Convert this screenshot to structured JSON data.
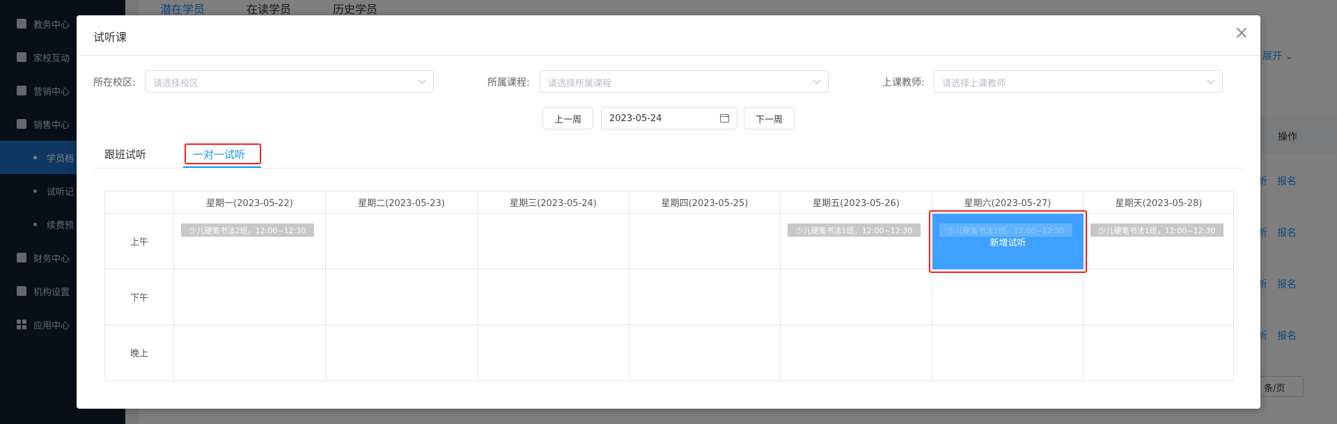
{
  "sidebar": {
    "items": [
      {
        "label": "教务中心",
        "icon": "book-icon"
      },
      {
        "label": "家校互动",
        "icon": "chat-icon"
      },
      {
        "label": "营销中心",
        "icon": "bag-icon"
      },
      {
        "label": "销售中心",
        "icon": "chart-icon"
      },
      {
        "label": "财务中心",
        "icon": "finance-icon"
      },
      {
        "label": "机构设置",
        "icon": "gear-icon"
      },
      {
        "label": "应用中心",
        "icon": "apps-icon"
      }
    ],
    "subitems": [
      {
        "label": "学员档",
        "active": true
      },
      {
        "label": "试听记",
        "active": false
      },
      {
        "label": "续费预",
        "active": false
      }
    ]
  },
  "main": {
    "tabs": [
      "潜在学员",
      "在读学员",
      "历史学员"
    ],
    "expand_label": "展开",
    "op_header": "操作",
    "row_links": [
      "报名",
      "报名",
      "报名",
      "报名"
    ],
    "partial_links": [
      "听",
      "听",
      "听",
      "听"
    ],
    "pager_label": "条/页"
  },
  "dialog": {
    "title": "试听课",
    "filters": {
      "campus_label": "所在校区:",
      "campus_placeholder": "请选择校区",
      "course_label": "所属课程:",
      "course_placeholder": "请选择所属课程",
      "teacher_label": "上课教师:",
      "teacher_placeholder": "请选择上课教师"
    },
    "week_nav": {
      "prev_label": "上一周",
      "date_value": "2023-05-24",
      "next_label": "下一周"
    },
    "tabs": [
      "跟班试听",
      "一对一试听"
    ],
    "active_tab": "一对一试听",
    "schedule": {
      "days": [
        "星期一(2023-05-22)",
        "星期二(2023-05-23)",
        "星期三(2023-05-24)",
        "星期四(2023-05-25)",
        "星期五(2023-05-26)",
        "星期六(2023-05-27)",
        "星期天(2023-05-28)"
      ],
      "periods": [
        "上午",
        "下午",
        "晚上"
      ],
      "lessons": {
        "mon_am": "少儿硬笔书法2班，12:00~12:30",
        "fri_am": "少儿硬笔书法1班，12:00~12:30",
        "sat_am_hidden": "少儿硬笔书法1班，12:00~12:30",
        "sun_am": "少儿硬笔书法1班，12:00~12:30"
      },
      "new_trial_label": "新增试听"
    },
    "colors": {
      "primary": "#1890ff",
      "highlight": "#ff1a1a",
      "new_trial_bg": "#3fa1ff",
      "lesson_tag_bg": "#c8c8c8"
    }
  }
}
